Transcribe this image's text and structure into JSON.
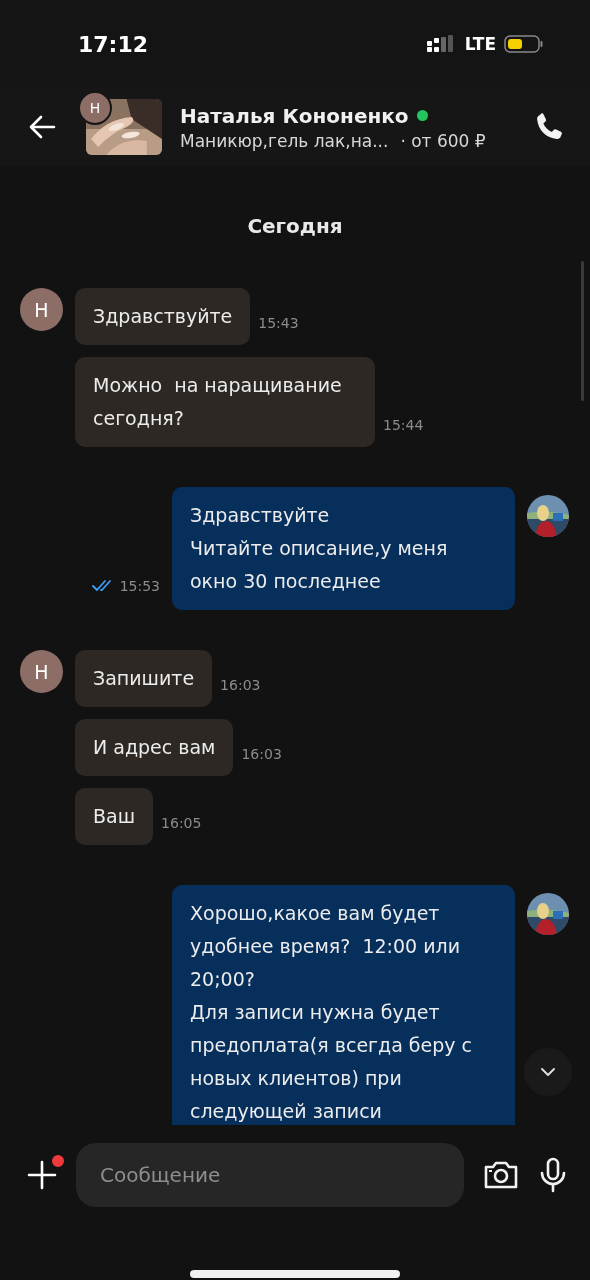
{
  "status_bar": {
    "time": "17:12",
    "network": "LTE"
  },
  "header": {
    "contact_initial": "Н",
    "name": "Наталья Кононенко",
    "online": true,
    "service": "Маникюр,гель лак,на...",
    "price": "· от 600 ₽"
  },
  "messages": [
    {
      "kind": "date",
      "text": "Сегодня"
    },
    {
      "kind": "incoming",
      "text": "Здравствуйте",
      "time": "15:43",
      "show_avatar": true,
      "initial": "Н"
    },
    {
      "kind": "incoming",
      "text": "Можно  на наращивание сегодня?",
      "time": "15:44",
      "show_avatar": false
    },
    {
      "kind": "outgoing",
      "text": "Здравствуйте\nЧитайте описание,у меня окно 30 последнее",
      "time": "15:53",
      "read": true,
      "show_avatar": true
    },
    {
      "kind": "incoming",
      "text": "Запишите",
      "time": "16:03",
      "show_avatar": true,
      "initial": "Н"
    },
    {
      "kind": "incoming",
      "text": "И адрес вам",
      "time": "16:03",
      "show_avatar": false
    },
    {
      "kind": "incoming",
      "text": "Ваш",
      "time": "16:05",
      "show_avatar": false
    },
    {
      "kind": "outgoing",
      "text": "Хорошо,какое вам будет удобнее время?  12:00 или 20;00?\nДля записи нужна будет предоплата(я всегда беру с новых клиентов) при следующей записи",
      "show_avatar": true
    }
  ],
  "composer": {
    "placeholder": "Сообщение",
    "attach_badge": true
  }
}
